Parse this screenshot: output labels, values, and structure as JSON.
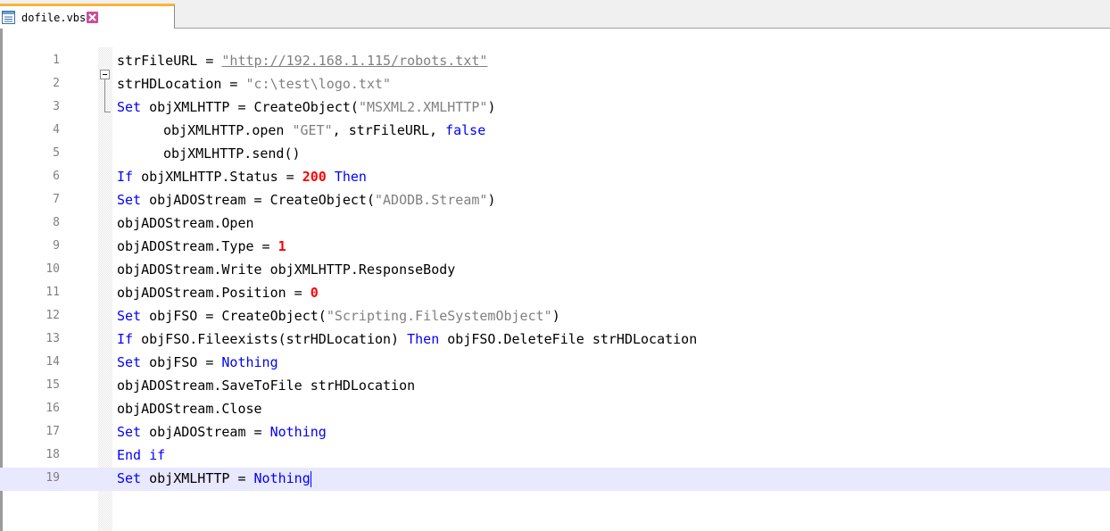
{
  "tab": {
    "filename": "dofile.vbs",
    "file_icon": "document-icon",
    "close_icon": "close-icon",
    "accent_color": "#f9b43a"
  },
  "editor": {
    "current_line": 19,
    "lines": [
      {
        "n": "1",
        "tokens": [
          {
            "t": "strFileURL = "
          },
          {
            "t": "\"http://192.168.1.115/robots.txt\"",
            "c": "url"
          }
        ]
      },
      {
        "n": "2",
        "tokens": [
          {
            "t": "strHDLocation = "
          },
          {
            "t": "\"c:\\test\\logo.txt\"",
            "c": "str"
          }
        ]
      },
      {
        "n": "3",
        "tokens": [
          {
            "t": "Set",
            "c": "kw"
          },
          {
            "t": " objXMLHTTP = CreateObject("
          },
          {
            "t": "\"MSXML2.XMLHTTP\"",
            "c": "str"
          },
          {
            "t": ")"
          }
        ]
      },
      {
        "n": "4",
        "indent": true,
        "tokens": [
          {
            "t": "objXMLHTTP.open "
          },
          {
            "t": "\"GET\"",
            "c": "str"
          },
          {
            "t": ", strFileURL, "
          },
          {
            "t": "false",
            "c": "kw"
          }
        ]
      },
      {
        "n": "5",
        "indent": true,
        "tokens": [
          {
            "t": "objXMLHTTP.send()"
          }
        ]
      },
      {
        "n": "6",
        "tokens": [
          {
            "t": "If",
            "c": "kw"
          },
          {
            "t": " objXMLHTTP.Status = "
          },
          {
            "t": "200",
            "c": "num"
          },
          {
            "t": " "
          },
          {
            "t": "Then",
            "c": "kw"
          }
        ]
      },
      {
        "n": "7",
        "tokens": [
          {
            "t": "Set",
            "c": "kw"
          },
          {
            "t": " objADOStream = CreateObject("
          },
          {
            "t": "\"ADODB.Stream\"",
            "c": "str"
          },
          {
            "t": ")"
          }
        ]
      },
      {
        "n": "8",
        "tokens": [
          {
            "t": "objADOStream.Open"
          }
        ]
      },
      {
        "n": "9",
        "tokens": [
          {
            "t": "objADOStream.Type = "
          },
          {
            "t": "1",
            "c": "num"
          }
        ]
      },
      {
        "n": "10",
        "tokens": [
          {
            "t": "objADOStream.Write objXMLHTTP.ResponseBody"
          }
        ]
      },
      {
        "n": "11",
        "tokens": [
          {
            "t": "objADOStream.Position = "
          },
          {
            "t": "0",
            "c": "num"
          }
        ]
      },
      {
        "n": "12",
        "tokens": [
          {
            "t": "Set",
            "c": "kw"
          },
          {
            "t": " objFSO = CreateObject("
          },
          {
            "t": "\"Scripting.FileSystemObject\"",
            "c": "str"
          },
          {
            "t": ")"
          }
        ]
      },
      {
        "n": "13",
        "tokens": [
          {
            "t": "If",
            "c": "kw"
          },
          {
            "t": " objFSO.Fileexists(strHDLocation) "
          },
          {
            "t": "Then",
            "c": "kw"
          },
          {
            "t": " objFSO.DeleteFile strHDLocation"
          }
        ]
      },
      {
        "n": "14",
        "tokens": [
          {
            "t": "Set",
            "c": "kw"
          },
          {
            "t": " objFSO = "
          },
          {
            "t": "Nothing",
            "c": "kw"
          }
        ]
      },
      {
        "n": "15",
        "tokens": [
          {
            "t": "objADOStream.SaveToFile strHDLocation"
          }
        ]
      },
      {
        "n": "16",
        "tokens": [
          {
            "t": "objADOStream.Close"
          }
        ]
      },
      {
        "n": "17",
        "tokens": [
          {
            "t": "Set",
            "c": "kw"
          },
          {
            "t": " objADOStream = "
          },
          {
            "t": "Nothing",
            "c": "kw"
          }
        ]
      },
      {
        "n": "18",
        "tokens": [
          {
            "t": "End if",
            "c": "kw"
          }
        ]
      },
      {
        "n": "19",
        "tokens": [
          {
            "t": "Set",
            "c": "kw"
          },
          {
            "t": " objXMLHTTP = "
          },
          {
            "t": "Nothing",
            "c": "kw"
          }
        ]
      }
    ],
    "colors": {
      "keyword": "#0000ff",
      "string": "#808080",
      "number": "#ff0000",
      "line_number": "#808080",
      "current_line_bg": "#e8e8ff"
    }
  }
}
